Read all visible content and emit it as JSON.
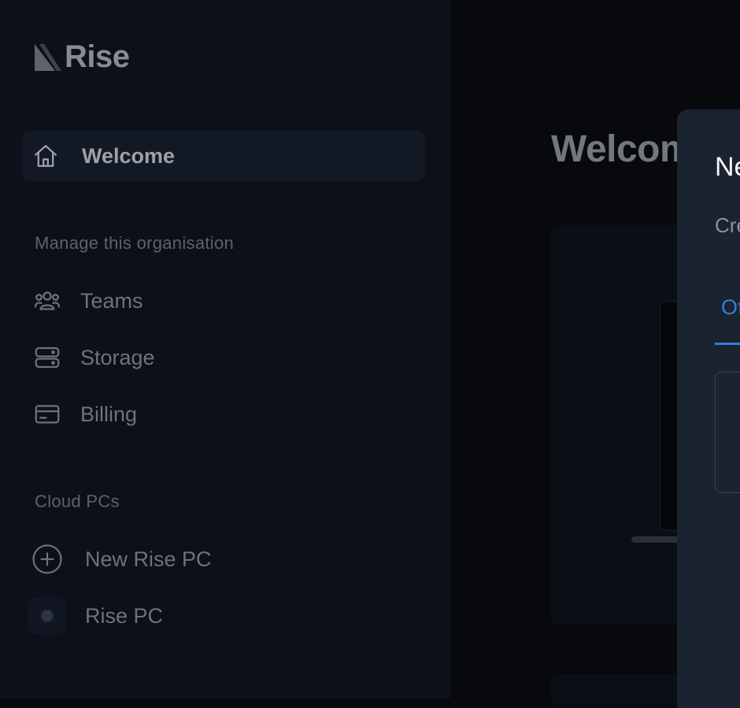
{
  "brand": {
    "name": "Rise"
  },
  "sidebar": {
    "welcome": "Welcome",
    "manage_section": "Manage this organisation",
    "manage_items": [
      {
        "label": "Teams",
        "icon": "users-icon"
      },
      {
        "label": "Storage",
        "icon": "server-icon"
      },
      {
        "label": "Billing",
        "icon": "credit-card-icon"
      }
    ],
    "cloud_section": "Cloud PCs",
    "new_pc": "New Rise PC",
    "pc_name": "Rise PC"
  },
  "main": {
    "title": "Welcome"
  },
  "modal": {
    "title": "New",
    "subtitle": "Create",
    "tab": "Of"
  }
}
